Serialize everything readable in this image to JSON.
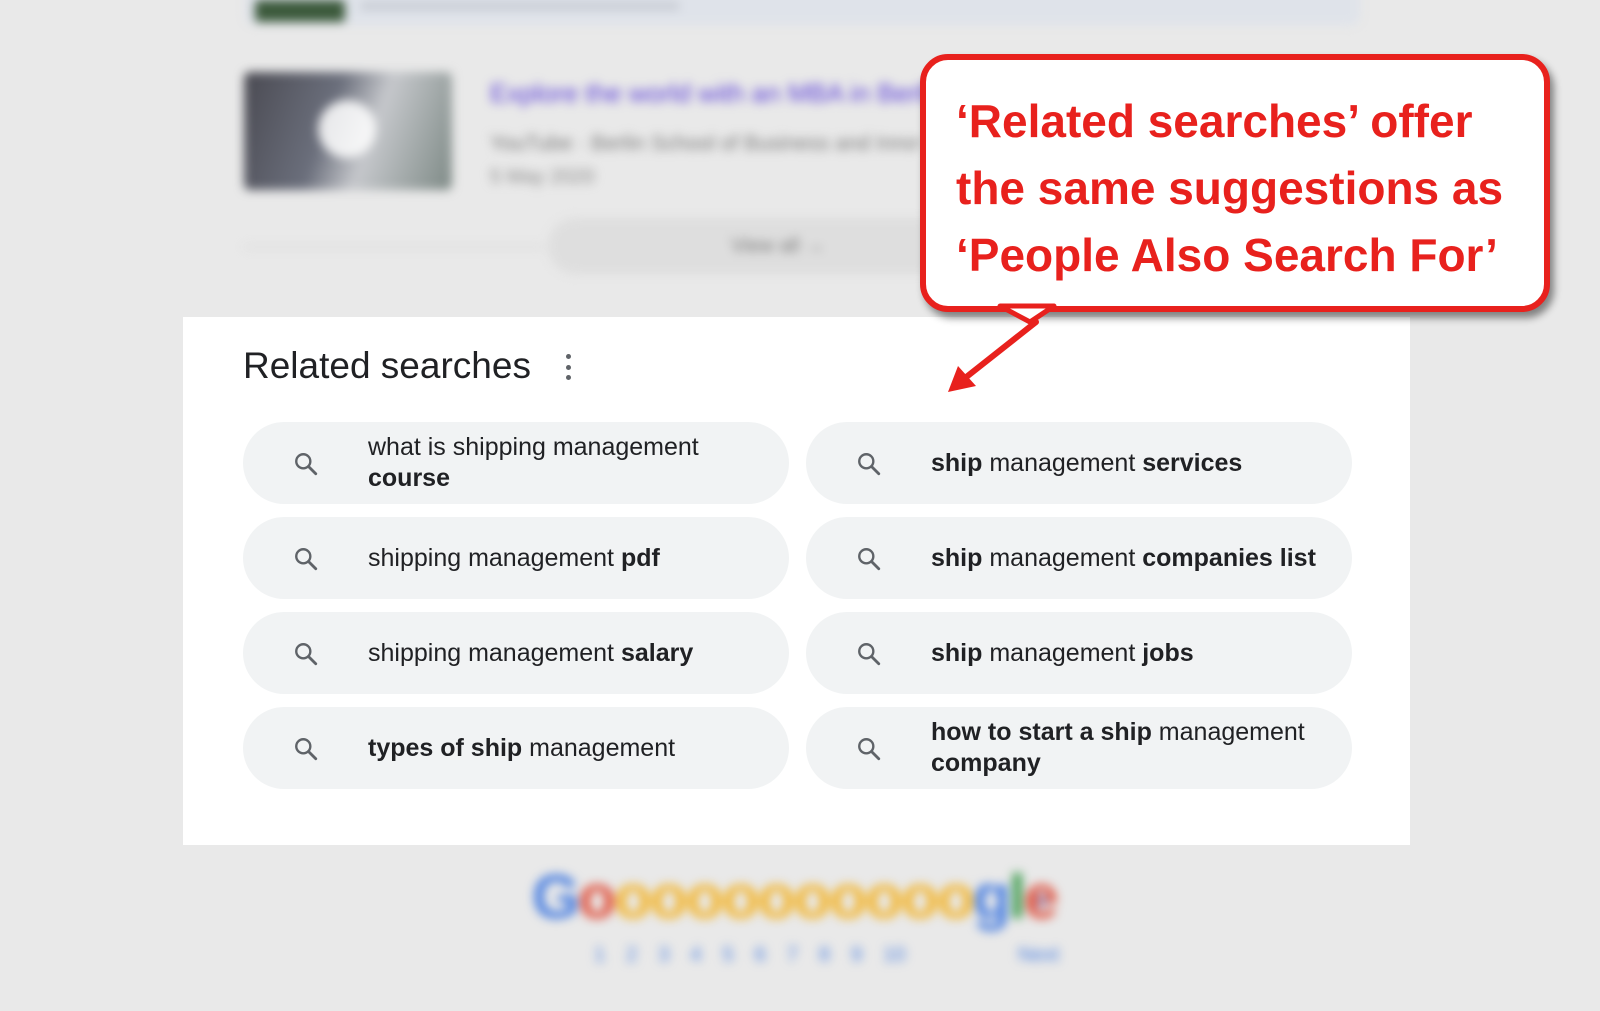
{
  "background": {
    "video": {
      "title": "Explore the world with an MBA in Berlin",
      "source": "YouTube · Berlin School of Business and Innovation",
      "date": "5 May 2020"
    },
    "view_all": "View all  →",
    "pager": {
      "logo_letters": [
        "G",
        "o",
        "o",
        "o",
        "o",
        "o",
        "o",
        "o",
        "o",
        "o",
        "o",
        "o",
        "g",
        "l",
        "e"
      ],
      "pages": [
        "1",
        "2",
        "3",
        "4",
        "5",
        "6",
        "7",
        "8",
        "9",
        "10"
      ],
      "next": "Next"
    }
  },
  "related": {
    "title": "Related searches",
    "items": [
      {
        "parts": [
          {
            "t": "what is shipping management ",
            "b": false
          },
          {
            "t": "course",
            "b": true
          }
        ]
      },
      {
        "parts": [
          {
            "t": "ship",
            "b": true
          },
          {
            "t": " management ",
            "b": false
          },
          {
            "t": "services",
            "b": true
          }
        ]
      },
      {
        "parts": [
          {
            "t": "shipping management ",
            "b": false
          },
          {
            "t": "pdf",
            "b": true
          }
        ]
      },
      {
        "parts": [
          {
            "t": "ship",
            "b": true
          },
          {
            "t": " management ",
            "b": false
          },
          {
            "t": "companies list",
            "b": true
          }
        ]
      },
      {
        "parts": [
          {
            "t": "shipping management ",
            "b": false
          },
          {
            "t": "salary",
            "b": true
          }
        ]
      },
      {
        "parts": [
          {
            "t": "ship",
            "b": true
          },
          {
            "t": " management ",
            "b": false
          },
          {
            "t": "jobs",
            "b": true
          }
        ]
      },
      {
        "parts": [
          {
            "t": "types of ship",
            "b": true
          },
          {
            "t": " management",
            "b": false
          }
        ]
      },
      {
        "parts": [
          {
            "t": "how to start a ship",
            "b": true
          },
          {
            "t": " management ",
            "b": false
          },
          {
            "t": "company",
            "b": true
          }
        ]
      }
    ]
  },
  "callout": {
    "text": "‘Related searches’ offer\nthe same suggestions as\n‘People Also Search For’",
    "color": "#e8211d"
  },
  "icons": {
    "chip_icon": "search-icon",
    "menu_icon": "more-vert-icon"
  }
}
